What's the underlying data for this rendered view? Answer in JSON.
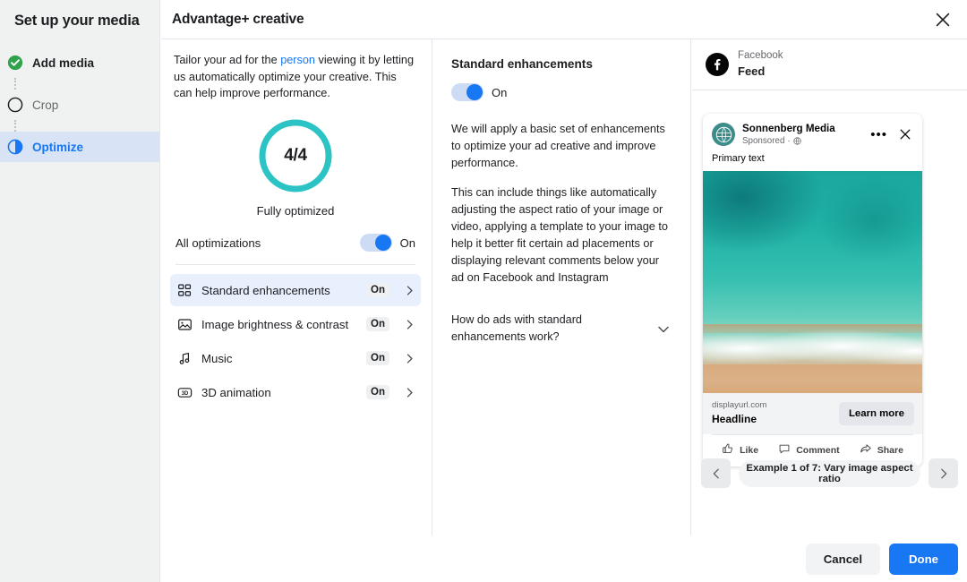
{
  "sidebar": {
    "title": "Set up your media",
    "items": [
      {
        "label": "Add media",
        "state": "done",
        "icon": "check-circle-icon"
      },
      {
        "label": "Crop",
        "state": "todo",
        "icon": "empty-circle-icon"
      },
      {
        "label": "Optimize",
        "state": "active",
        "icon": "half-circle-icon"
      }
    ]
  },
  "header": {
    "title": "Advantage+ creative",
    "close_icon": "close-icon"
  },
  "optimize": {
    "intro_before": "Tailor your ad for the ",
    "intro_link": "person",
    "intro_after": " viewing it by letting us automatically optimize your creative. This can help improve performance.",
    "score": "4/4",
    "score_caption": "Fully optimized",
    "all_optimizations_label": "All optimizations",
    "all_optimizations_state": "On",
    "ring_color": "#2cc3c4",
    "accent_color": "#1877f2",
    "rows": [
      {
        "label": "Standard enhancements",
        "state": "On",
        "icon": "grid-tiles-icon",
        "selected": true
      },
      {
        "label": "Image brightness & contrast",
        "state": "On",
        "icon": "image-icon",
        "selected": false
      },
      {
        "label": "Music",
        "state": "On",
        "icon": "music-note-icon",
        "selected": false
      },
      {
        "label": "3D animation",
        "state": "On",
        "icon": "3d-icon",
        "selected": false
      }
    ]
  },
  "detail": {
    "title": "Standard enhancements",
    "toggle_state": "On",
    "paragraphs": [
      "We will apply a basic set of enhancements to optimize your ad creative and improve performance.",
      "This can include things like automatically adjusting the aspect ratio of your image or video, applying a template to your image to help it better fit certain ad placements or displaying relevant comments below your ad on Facebook and Instagram"
    ],
    "faq_question": "How do ads with standard enhancements work?",
    "faq_chevron_icon": "chevron-down-icon"
  },
  "preview": {
    "platform": "Facebook",
    "placement": "Feed",
    "facebook_icon": "facebook-icon",
    "ad": {
      "advertiser": "Sonnenberg Media",
      "sponsored": "Sponsored",
      "globe_icon": "globe-icon",
      "menu_icon": "more-options-icon",
      "close_icon": "close-icon",
      "primary_text": "Primary text",
      "display_url": "displayurl.com",
      "headline": "Headline",
      "cta": "Learn more",
      "actions": [
        {
          "label": "Like",
          "icon": "thumbs-up-icon"
        },
        {
          "label": "Comment",
          "icon": "comment-bubble-icon"
        },
        {
          "label": "Share",
          "icon": "share-arrow-icon"
        }
      ]
    },
    "carousel": {
      "prev_icon": "chevron-left-icon",
      "next_icon": "chevron-right-icon",
      "label": "Example 1 of 7: Vary image aspect ratio"
    }
  },
  "footer": {
    "cancel_label": "Cancel",
    "done_label": "Done"
  }
}
